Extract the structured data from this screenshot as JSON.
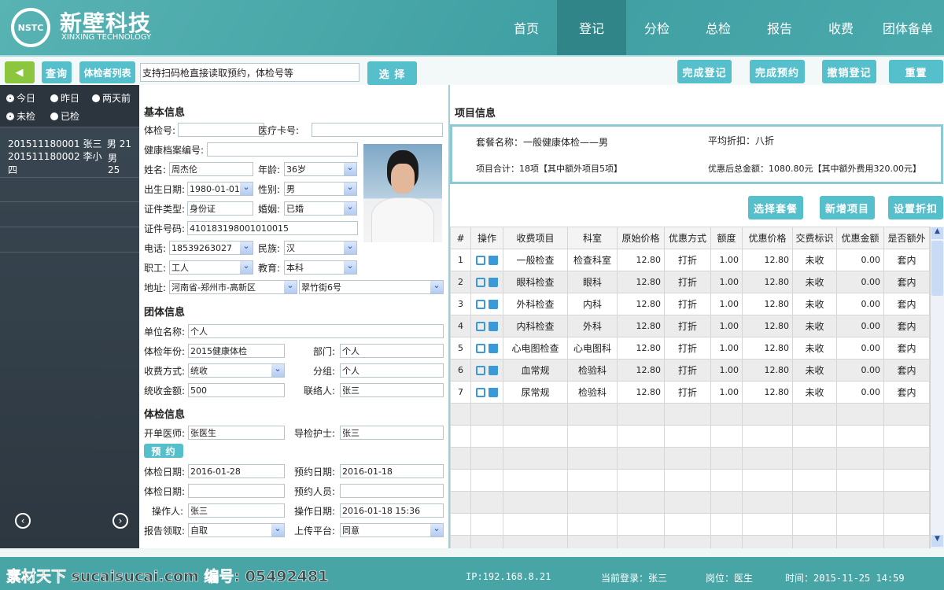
{
  "header": {
    "logo_mark": "NSTC",
    "logo_cn": "新壁科技",
    "logo_en": "XINXING TECHNOLOGY",
    "nav": [
      {
        "label": "首页"
      },
      {
        "label": "登记",
        "active": true
      },
      {
        "label": "分检"
      },
      {
        "label": "总检"
      },
      {
        "label": "报告"
      },
      {
        "label": "收费"
      },
      {
        "label": "团体备单"
      }
    ]
  },
  "toolbar": {
    "back_icon": "triangle-left-icon",
    "query": "查询",
    "list": "体检者列表",
    "search_placeholder": "支持扫码枪直接读取预约，体检号等",
    "select": "选  择",
    "actions": [
      "完成登记",
      "完成预约",
      "撤销登记",
      "重置"
    ]
  },
  "sidebar": {
    "date_filters": [
      {
        "label": "今日",
        "checked": true
      },
      {
        "label": "昨日",
        "checked": false
      },
      {
        "label": "两天前",
        "checked": false
      }
    ],
    "status_filters": [
      {
        "label": "未检",
        "checked": true
      },
      {
        "label": "已检",
        "checked": false
      }
    ],
    "patients": [
      {
        "id": "201511180001",
        "name": "张三",
        "info": "男 21"
      },
      {
        "id": "201511180002",
        "name": "李小四",
        "info": "男 25"
      }
    ],
    "prev_icon": "chevron-left-circle-icon",
    "next_icon": "chevron-right-circle-icon"
  },
  "basic": {
    "title": "基本信息",
    "exam_no_label": "体检号:",
    "exam_no": "",
    "card_label": "医疗卡号:",
    "card": "",
    "archive_label": "健康档案编号:",
    "archive": "",
    "name_label": "姓名:",
    "name": "周杰伦",
    "age_label": "年龄:",
    "age": "36岁",
    "birth_label": "出生日期:",
    "birth": "1980-01-01",
    "sex_label": "性别:",
    "sex": "男",
    "idtype_label": "证件类型:",
    "idtype": "身份证",
    "marriage_label": "婚姻:",
    "marriage": "已婚",
    "idno_label": "证件号码:",
    "idno": "410183198001010015",
    "phone_label": "电话:",
    "phone": "18539263027",
    "nation_label": "民族:",
    "nation": "汉",
    "job_label": "职工:",
    "job": "工人",
    "edu_label": "教育:",
    "edu": "本科",
    "addr_label": "地址:",
    "addr1": "河南省-郑州市-高新区",
    "addr2": "翠竹街6号"
  },
  "group": {
    "title": "团体信息",
    "unit_label": "单位名称:",
    "unit": "个人",
    "year_label": "体检年份:",
    "year": "2015健康体检",
    "dept_label": "部门:",
    "dept": "个人",
    "pay_label": "收费方式:",
    "pay": "统收",
    "team_label": "分组:",
    "team": "个人",
    "amount_label": "统收金额:",
    "amount": "500",
    "contact_label": "联络人:",
    "contact": "张三"
  },
  "exam": {
    "title": "体检信息",
    "doctor_label": "开单医师:",
    "doctor": "张医生",
    "nurse_label": "导检护士:",
    "nurse": "张三",
    "book_btn": "预 约",
    "date_label": "体检日期:",
    "date": "2016-01-28",
    "bdate_label": "预约日期:",
    "bdate": "2016-01-18",
    "date2_label": "体检日期:",
    "date2": "",
    "bperson_label": "预约人员:",
    "bperson": "",
    "op_label": "操作人:",
    "op": "张三",
    "opdate_label": "操作日期:",
    "opdate": "2016-01-18 15:36",
    "report_label": "报告领取:",
    "report": "自取",
    "upload_label": "上传平台:",
    "upload": "同意"
  },
  "project": {
    "title": "项目信息",
    "pkg": "套餐名称：一般健康体检——男",
    "avg": "平均折扣：八折",
    "total": "项目合计：18项【其中额外项目5项】",
    "sum": "优惠后总金额：1080.80元【其中额外费用320.00元】",
    "buttons": [
      "选择套餐",
      "新增项目",
      "设置折扣"
    ],
    "columns": [
      "#",
      "操作",
      "收费项目",
      "科室",
      "原始价格",
      "优惠方式",
      "额度",
      "优惠价格",
      "交费标识",
      "优惠金额",
      "是否额外"
    ],
    "rows": [
      [
        "1",
        "一般检查",
        "检查科室",
        "12.80",
        "打折",
        "1.00",
        "12.80",
        "未收",
        "0.00",
        "套内"
      ],
      [
        "2",
        "眼科检查",
        "眼科",
        "12.80",
        "打折",
        "1.00",
        "12.80",
        "未收",
        "0.00",
        "套内"
      ],
      [
        "3",
        "外科检查",
        "内科",
        "12.80",
        "打折",
        "1.00",
        "12.80",
        "未收",
        "0.00",
        "套内"
      ],
      [
        "4",
        "内科检查",
        "外科",
        "12.80",
        "打折",
        "1.00",
        "12.80",
        "未收",
        "0.00",
        "套内"
      ],
      [
        "5",
        "心电图检查",
        "心电图科",
        "12.80",
        "打折",
        "1.00",
        "12.80",
        "未收",
        "0.00",
        "套内"
      ],
      [
        "6",
        "血常规",
        "检验科",
        "12.80",
        "打折",
        "1.00",
        "12.80",
        "未收",
        "0.00",
        "套内"
      ],
      [
        "7",
        "尿常规",
        "检验科",
        "12.80",
        "打折",
        "1.00",
        "12.80",
        "未收",
        "0.00",
        "套内"
      ]
    ]
  },
  "footer": {
    "watermark": "素材天下 sucaisucai.com  编号: 05492481",
    "ip": "IP:192.168.8.21",
    "user": "当前登录：张三",
    "post": "岗位：医生",
    "time": "时间：2015-11-25  14:59"
  },
  "colors": {
    "teal": "#56bfcc",
    "header": "#4aa8a8",
    "sidebar": "#2d3740",
    "active_nav": "#2f8588",
    "back_btn": "#8cc63f"
  }
}
